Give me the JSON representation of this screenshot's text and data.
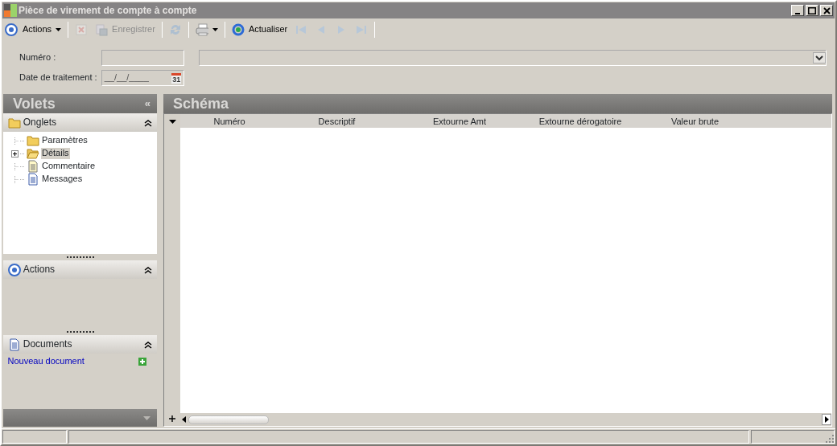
{
  "window": {
    "title": "Pièce de virement de compte à compte"
  },
  "toolbar": [
    {
      "kind": "menu",
      "label": "Actions",
      "disabled": false
    },
    {
      "kind": "separator"
    },
    {
      "kind": "button",
      "disabled": true
    },
    {
      "kind": "button",
      "label": "Enregistrer",
      "disabled": true
    },
    {
      "kind": "separator"
    },
    {
      "kind": "button",
      "disabled": true
    },
    {
      "kind": "separator"
    },
    {
      "kind": "menu",
      "disabled": false
    },
    {
      "kind": "separator"
    },
    {
      "kind": "button",
      "label": "Actualiser",
      "disabled": false
    },
    {
      "kind": "button",
      "disabled": true
    },
    {
      "kind": "button",
      "disabled": true
    },
    {
      "kind": "button",
      "disabled": true
    },
    {
      "kind": "button",
      "disabled": true
    },
    {
      "kind": "separator"
    }
  ],
  "form": {
    "numero_label": "Numéro :",
    "date_label": "Date de traitement :",
    "date_value": "__/__/____",
    "calendar_day": "31"
  },
  "sidebar": {
    "title": "Volets",
    "collapse": "«",
    "sections": [
      {
        "kind": "tree",
        "title": "Onglets",
        "expanded": true,
        "items": [
          {
            "label": "Paramètres",
            "kind": "folder",
            "selected": false,
            "expandable": false
          },
          {
            "label": "Détails",
            "kind": "folder",
            "selected": true,
            "expandable": true
          },
          {
            "label": "Commentaire",
            "kind": "note",
            "selected": false,
            "expandable": false
          },
          {
            "label": "Messages",
            "kind": "document",
            "selected": false,
            "expandable": false
          }
        ]
      },
      {
        "kind": "empty",
        "title": "Actions",
        "expanded": true
      },
      {
        "kind": "links",
        "title": "Documents",
        "expanded": true,
        "links": [
          "Nouveau document"
        ]
      }
    ]
  },
  "main": {
    "title": "Schéma",
    "table": {
      "columns": [
        "Numéro",
        "Descriptif",
        "Extourne Amt",
        "Extourne dérogatoire",
        "Valeur brute"
      ]
    }
  }
}
